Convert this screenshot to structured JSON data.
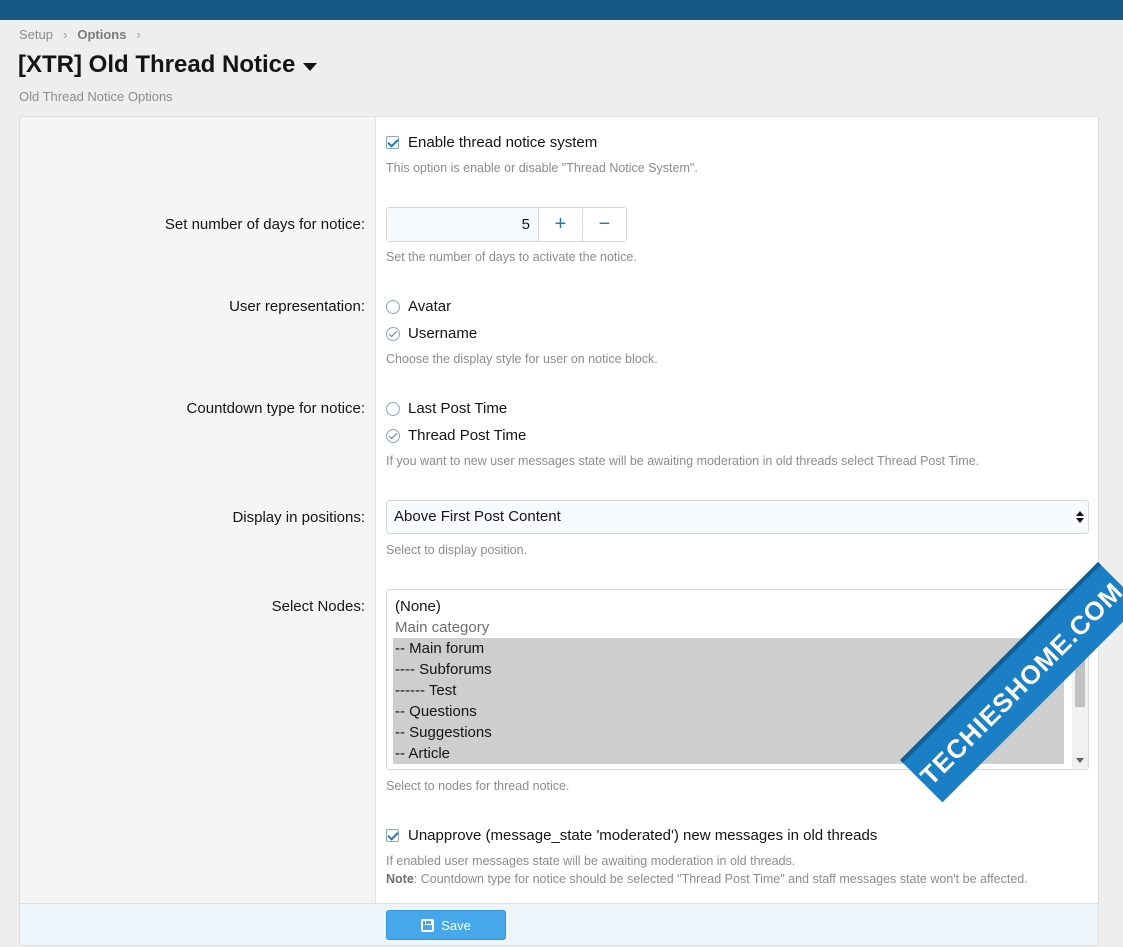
{
  "breadcrumb": {
    "items": [
      "Setup",
      "Options"
    ]
  },
  "page": {
    "title": "[XTR] Old Thread Notice",
    "description": "Old Thread Notice Options"
  },
  "options": {
    "enable": {
      "label": "Enable thread notice system",
      "checked": true,
      "hint": "This option is enable or disable \"Thread Notice System\"."
    },
    "days": {
      "label": "Set number of days for notice:",
      "value": "5",
      "increment": "+",
      "decrement": "−",
      "hint": "Set the number of days to activate the notice."
    },
    "user_rep": {
      "label": "User representation:",
      "choices": [
        "Avatar",
        "Username"
      ],
      "selected": "Username",
      "hint": "Choose the display style for user on notice block."
    },
    "countdown": {
      "label": "Countdown type for notice:",
      "choices": [
        "Last Post Time",
        "Thread Post Time"
      ],
      "selected": "Thread Post Time",
      "hint": "If you want to new user messages state will be awaiting moderation in old threads select Thread Post Time."
    },
    "position": {
      "label": "Display in positions:",
      "value": "Above First Post Content",
      "hint": "Select to display position."
    },
    "nodes": {
      "label": "Select Nodes:",
      "items": [
        "(None)",
        "Main category",
        "-- Main forum",
        "---- Subforums",
        "------ Test",
        "-- Questions",
        "-- Suggestions",
        "-- Article"
      ],
      "selected": [
        "-- Main forum",
        "---- Subforums",
        "------ Test",
        "-- Questions",
        "-- Suggestions",
        "-- Article"
      ],
      "hint": "Select to nodes for thread notice."
    },
    "unapprove": {
      "label": "Unapprove (message_state 'moderated') new messages in old threads",
      "checked": true,
      "hint1": "If enabled user messages state will be awaiting moderation in old threads.",
      "hint2_bold": "Note",
      "hint2": ": Countdown type for notice should be selected \"Thread Post Time\" and staff messages state won't be affected."
    }
  },
  "footer": {
    "save_label": "Save"
  },
  "watermark": {
    "text": "TECHIESHOME.COM"
  },
  "colors": {
    "topbar": "#185886",
    "accent": "#2577b1",
    "save": "#47a7eb"
  }
}
